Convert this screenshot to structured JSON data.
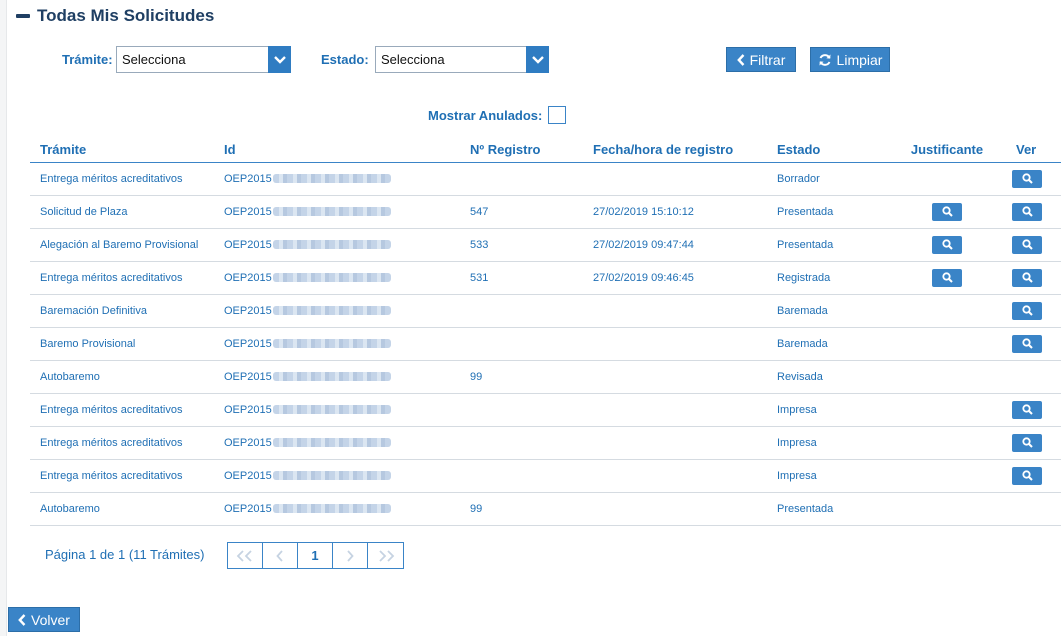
{
  "header": {
    "title": "Todas Mis Solicitudes"
  },
  "filters": {
    "tramite_label": "Trámite:",
    "tramite_value": "Selecciona",
    "estado_label": "Estado:",
    "estado_value": "Selecciona",
    "filtrar_label": "Filtrar",
    "limpiar_label": "Limpiar",
    "anulados_label": "Mostrar Anulados:",
    "anulados_checked": false
  },
  "table": {
    "columns": [
      "Trámite",
      "Id",
      "Nº Registro",
      "Fecha/hora de registro",
      "Estado",
      "Justificante",
      "Ver"
    ],
    "id_prefix": "OEP2015",
    "rows": [
      {
        "tramite": "Entrega méritos acreditativos",
        "registro": "",
        "fecha": "",
        "estado": "Borrador",
        "justificante": false,
        "ver": true
      },
      {
        "tramite": "Solicitud de Plaza",
        "registro": "547",
        "fecha": "27/02/2019 15:10:12",
        "estado": "Presentada",
        "justificante": true,
        "ver": true
      },
      {
        "tramite": "Alegación al Baremo Provisional",
        "registro": "533",
        "fecha": "27/02/2019 09:47:44",
        "estado": "Presentada",
        "justificante": true,
        "ver": true
      },
      {
        "tramite": "Entrega méritos acreditativos",
        "registro": "531",
        "fecha": "27/02/2019 09:46:45",
        "estado": "Registrada",
        "justificante": true,
        "ver": true
      },
      {
        "tramite": "Baremación Definitiva",
        "registro": "",
        "fecha": "",
        "estado": "Baremada",
        "justificante": false,
        "ver": true
      },
      {
        "tramite": "Baremo Provisional",
        "registro": "",
        "fecha": "",
        "estado": "Baremada",
        "justificante": false,
        "ver": true
      },
      {
        "tramite": "Autobaremo",
        "registro": "99",
        "fecha": "",
        "estado": "Revisada",
        "justificante": false,
        "ver": false
      },
      {
        "tramite": "Entrega méritos acreditativos",
        "registro": "",
        "fecha": "",
        "estado": "Impresa",
        "justificante": false,
        "ver": true
      },
      {
        "tramite": "Entrega méritos acreditativos",
        "registro": "",
        "fecha": "",
        "estado": "Impresa",
        "justificante": false,
        "ver": true
      },
      {
        "tramite": "Entrega méritos acreditativos",
        "registro": "",
        "fecha": "",
        "estado": "Impresa",
        "justificante": false,
        "ver": true
      },
      {
        "tramite": "Autobaremo",
        "registro": "99",
        "fecha": "",
        "estado": "Presentada",
        "justificante": false,
        "ver": false
      }
    ]
  },
  "pagination": {
    "info": "Página 1 de 1 (11 Trámites)",
    "current_page": "1"
  },
  "footer": {
    "back_label": "Volver"
  },
  "colors": {
    "accent": "#3a84c7",
    "text": "#1f6fb4",
    "title": "#1f3f63"
  }
}
